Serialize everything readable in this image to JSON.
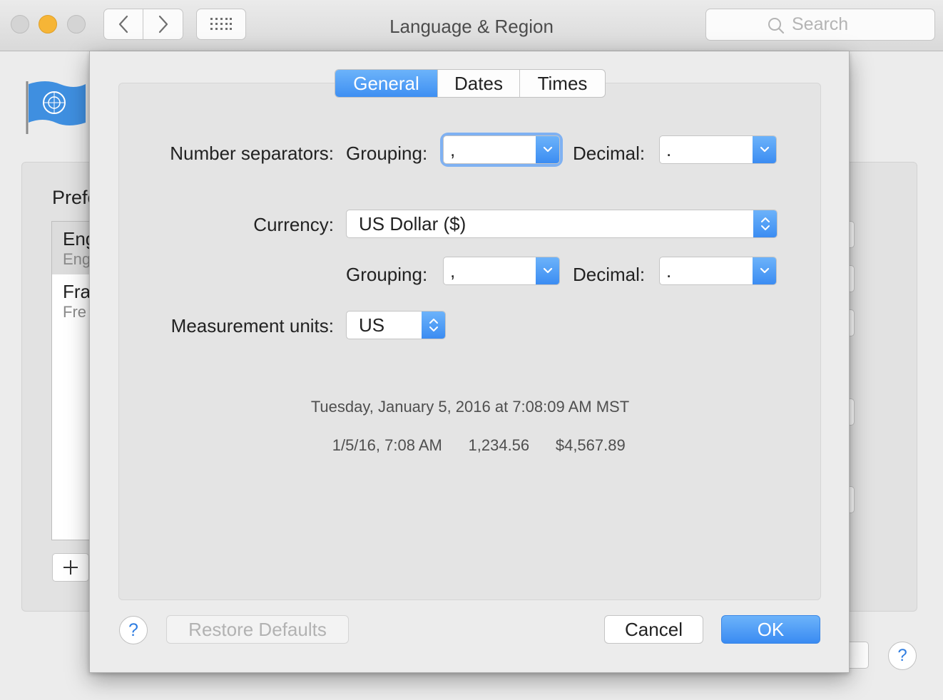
{
  "window": {
    "title": "Language & Region",
    "search_placeholder": "Search"
  },
  "background": {
    "preferred_label": "Prefe",
    "languages": [
      {
        "name": "Eng",
        "native": "Eng"
      },
      {
        "name": "Fra",
        "native": "Fre"
      }
    ],
    "add_button": "+",
    "help": "?"
  },
  "sheet": {
    "tabs": [
      {
        "label": "General",
        "active": true
      },
      {
        "label": "Dates",
        "active": false
      },
      {
        "label": "Times",
        "active": false
      }
    ],
    "number_separators": {
      "label": "Number separators:",
      "grouping_label": "Grouping:",
      "grouping_value": ",",
      "decimal_label": "Decimal:",
      "decimal_value": "."
    },
    "currency": {
      "label": "Currency:",
      "value": "US Dollar ($)",
      "grouping_label": "Grouping:",
      "grouping_value": ",",
      "decimal_label": "Decimal:",
      "decimal_value": "."
    },
    "measurement": {
      "label": "Measurement units:",
      "value": "US"
    },
    "preview": {
      "line1": "Tuesday, January 5, 2016 at 7:08:09 AM MST",
      "line2_date": "1/5/16, 7:08 AM",
      "line2_number": "1,234.56",
      "line2_currency": "$4,567.89"
    },
    "buttons": {
      "help": "?",
      "restore": "Restore Defaults",
      "cancel": "Cancel",
      "ok": "OK"
    }
  },
  "colors": {
    "accent": "#3e8ff2",
    "focus_ring": "#7fb1f2",
    "minimize": "#f6b536"
  }
}
